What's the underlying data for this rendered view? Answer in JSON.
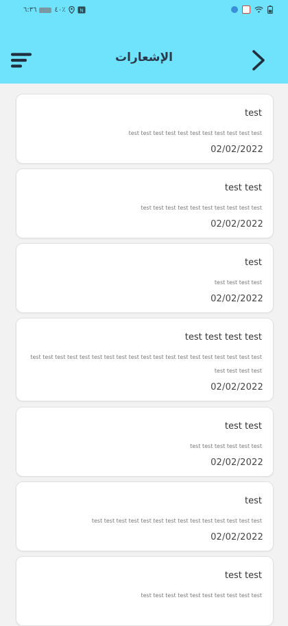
{
  "status_bar": {
    "time": "٦:٣٦",
    "percent": "٤٠٪"
  },
  "header": {
    "title": "الإشعارات"
  },
  "notifications": [
    {
      "title": "test",
      "body": "test test test test test test test test test test test",
      "date": "02/02/2022"
    },
    {
      "title": "test test",
      "body": "test test test test test test test test test test",
      "date": "02/02/2022"
    },
    {
      "title": "test",
      "body": "test test test test",
      "date": "02/02/2022"
    },
    {
      "title": "test test test test",
      "body": "test test test test test test test test test test test test test test test test test test test test test test test",
      "date": "02/02/2022"
    },
    {
      "title": "test test",
      "body": "test test test test test test",
      "date": "02/02/2022"
    },
    {
      "title": "test",
      "body": "test test test test test test test test test test test test test test",
      "date": "02/02/2022"
    },
    {
      "title": "test test",
      "body": "test test test test test test test test test test",
      "date": ""
    }
  ]
}
